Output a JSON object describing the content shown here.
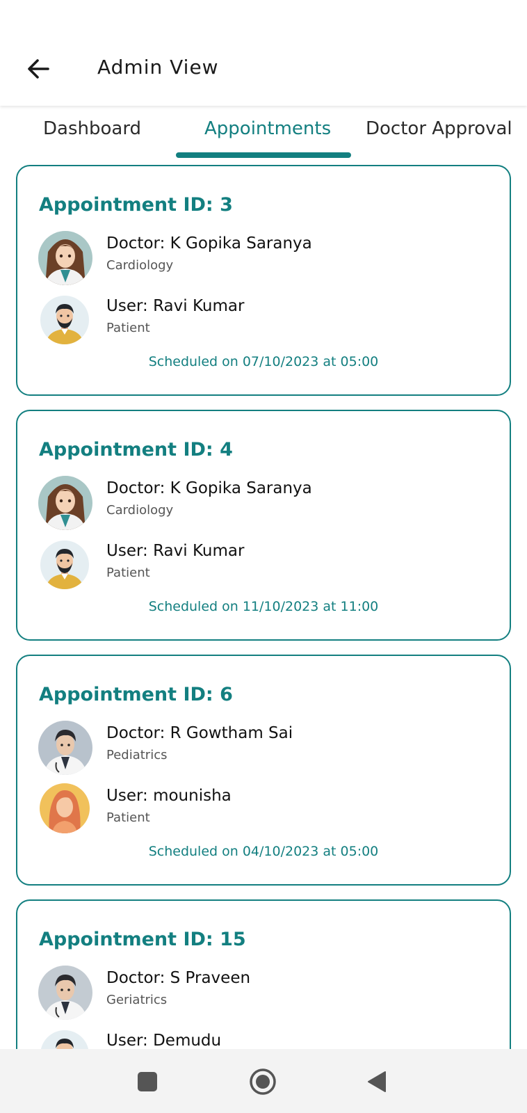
{
  "header": {
    "title": "Admin View"
  },
  "tabs": [
    {
      "label": "Dashboard"
    },
    {
      "label": "Appointments"
    },
    {
      "label": "Doctor Approval"
    }
  ],
  "appointments": [
    {
      "title": "Appointment ID: 3",
      "doctor": "Doctor: K Gopika Saranya",
      "specialty": "Cardiology",
      "user": "User: Ravi Kumar",
      "role": "Patient",
      "schedule": "Scheduled on 07/10/2023 at 05:00"
    },
    {
      "title": "Appointment ID: 4",
      "doctor": "Doctor: K Gopika Saranya",
      "specialty": "Cardiology",
      "user": "User: Ravi Kumar",
      "role": "Patient",
      "schedule": "Scheduled on 11/10/2023 at 11:00"
    },
    {
      "title": "Appointment ID: 6",
      "doctor": "Doctor: R Gowtham Sai",
      "specialty": "Pediatrics",
      "user": "User: mounisha",
      "role": "Patient",
      "schedule": "Scheduled on 04/10/2023 at 05:00"
    },
    {
      "title": "Appointment ID: 15",
      "doctor": "Doctor: S Praveen",
      "specialty": "Geriatrics",
      "user": "User: Demudu",
      "role": "",
      "schedule": ""
    }
  ],
  "colors": {
    "accent": "#137f80",
    "text": "#1a1a1a",
    "subtext": "#555555"
  }
}
